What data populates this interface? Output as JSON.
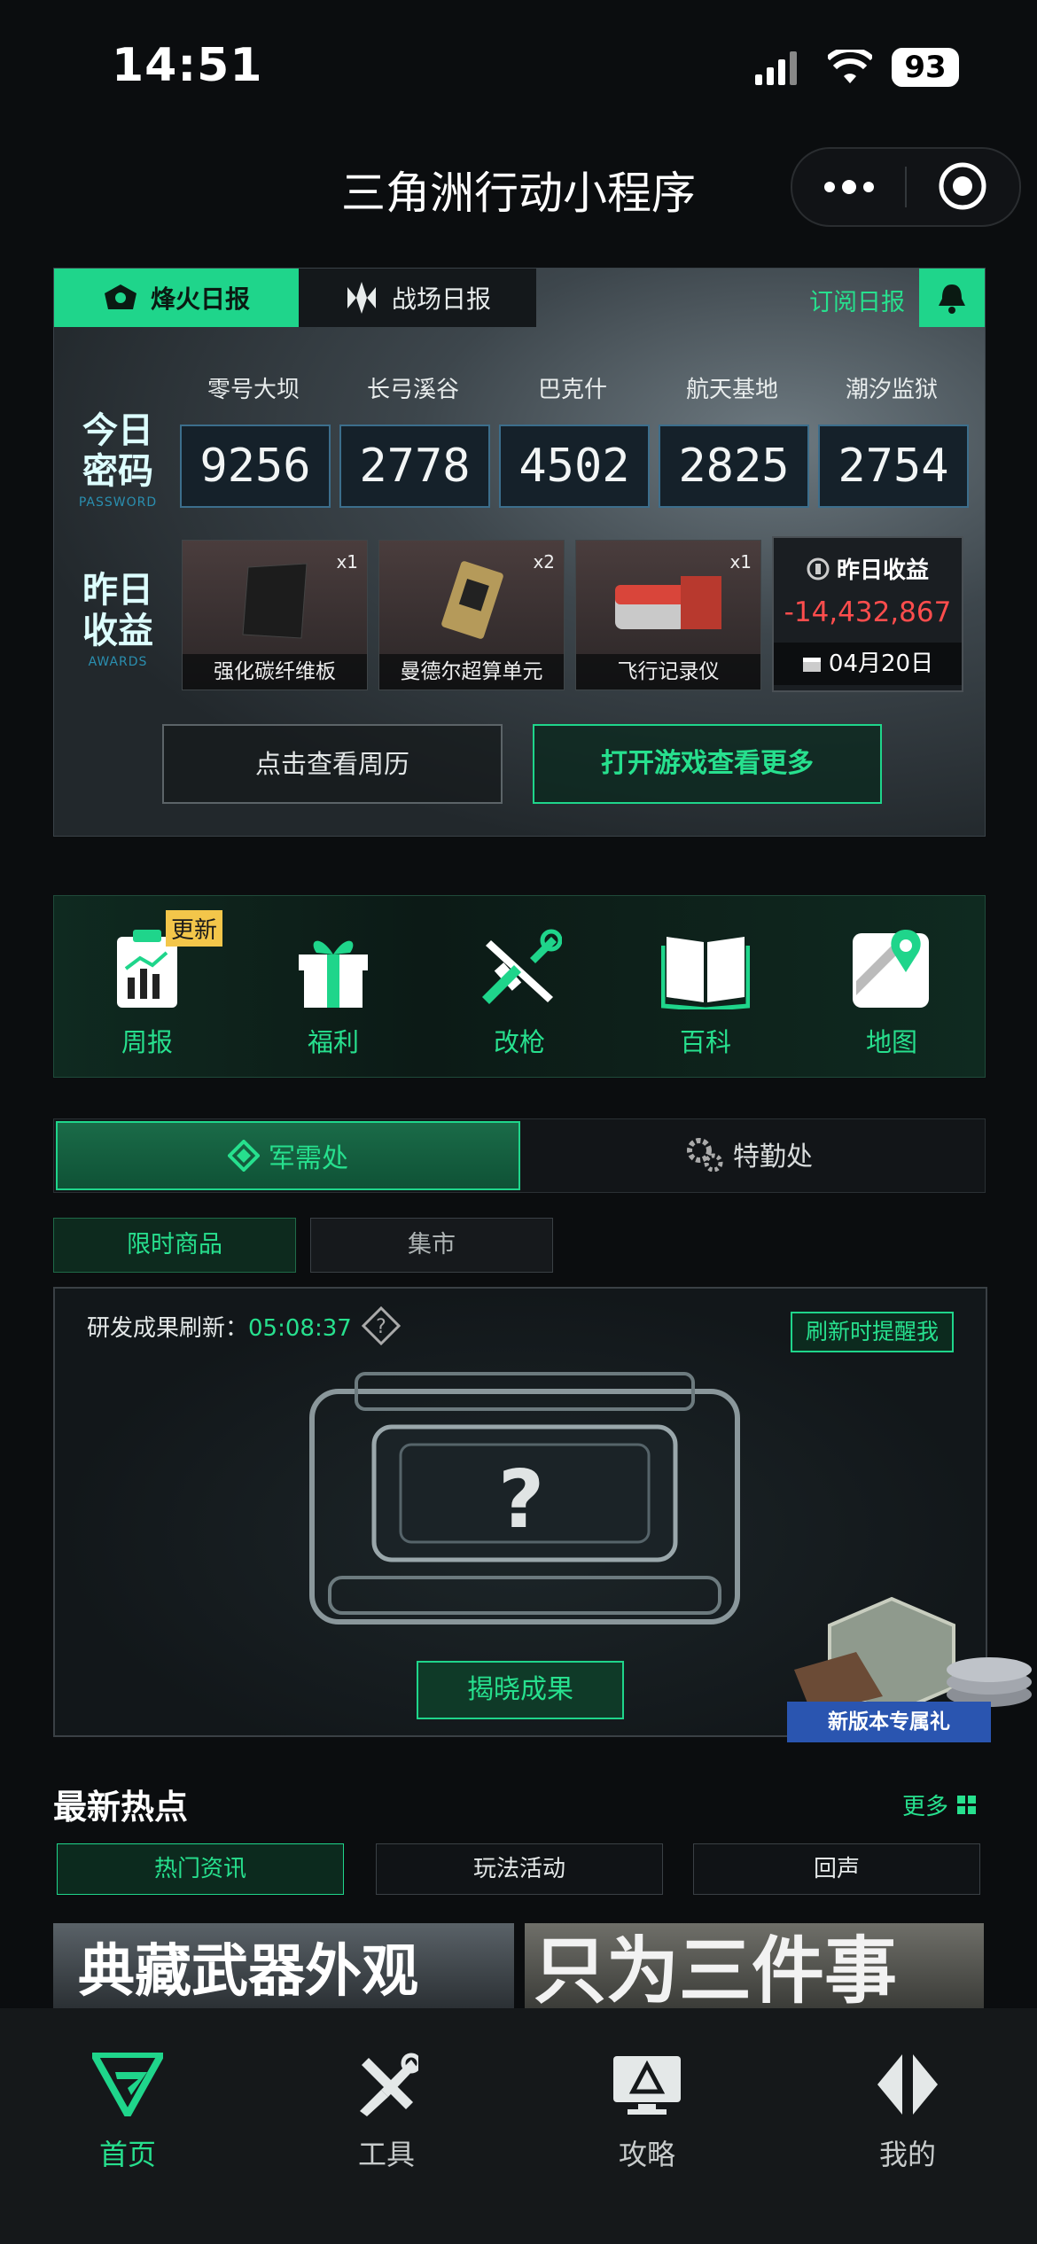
{
  "status_bar": {
    "time": "14:51",
    "battery": "93"
  },
  "app_title": "三角洲行动小程序",
  "daily": {
    "tabs": [
      "烽火日报",
      "战场日报"
    ],
    "subscribe": "订阅日报",
    "today_code_title": [
      "今日",
      "密码"
    ],
    "today_code_sub": "PASSWORD",
    "maps": [
      {
        "name": "零号大坝",
        "code": "9256"
      },
      {
        "name": "长弓溪谷",
        "code": "2778"
      },
      {
        "name": "巴克什",
        "code": "4502"
      },
      {
        "name": "航天基地",
        "code": "2825"
      },
      {
        "name": "潮汐监狱",
        "code": "2754"
      }
    ],
    "awards_title": [
      "昨日",
      "收益"
    ],
    "awards_sub": "AWARDS",
    "items": [
      {
        "name": "强化碳纤维板",
        "qty": "x1"
      },
      {
        "name": "曼德尔超算单元",
        "qty": "x2"
      },
      {
        "name": "飞行记录仪",
        "qty": "x1"
      }
    ],
    "income_title": "昨日收益",
    "income_value": "-14,432,867",
    "income_date": "04月20日",
    "btn_week": "点击查看周历",
    "btn_open": "打开游戏查看更多"
  },
  "nav": {
    "badge": "更新",
    "items": [
      {
        "label": "周报",
        "icon": "report-icon"
      },
      {
        "label": "福利",
        "icon": "gift-icon"
      },
      {
        "label": "改枪",
        "icon": "gun-wrench-icon"
      },
      {
        "label": "百科",
        "icon": "book-icon"
      },
      {
        "label": "地图",
        "icon": "map-pin-icon"
      }
    ]
  },
  "shop": {
    "tabs": [
      "军需处",
      "特勤处"
    ],
    "subtabs": [
      "限时商品",
      "集市"
    ],
    "research_label": "研发成果刷新：",
    "research_time": "05:08:37",
    "remind": "刷新时提醒我",
    "question": "?",
    "reveal": "揭晓成果",
    "gift_label": "新版本专属礼"
  },
  "hot": {
    "title": "最新热点",
    "more": "更多",
    "tabs": [
      "热门资讯",
      "玩法活动",
      "回声"
    ],
    "news": [
      "典藏武器外观",
      "只为三件事"
    ]
  },
  "tabbar": [
    {
      "label": "首页",
      "icon": "home-icon"
    },
    {
      "label": "工具",
      "icon": "tools-icon"
    },
    {
      "label": "攻略",
      "icon": "guide-icon"
    },
    {
      "label": "我的",
      "icon": "profile-icon"
    }
  ],
  "colors": {
    "accent": "#1fd58b",
    "negative": "#ff4d4d",
    "badge": "#f3c64a"
  }
}
